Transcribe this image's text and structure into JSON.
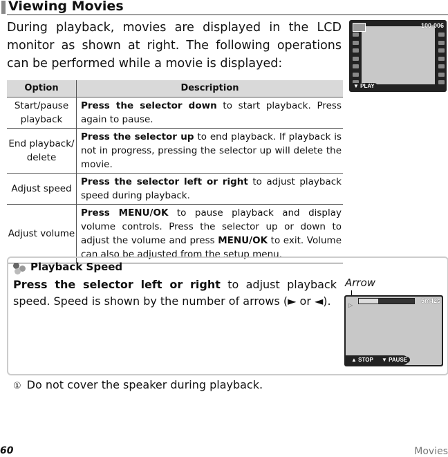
{
  "heading": "Viewing Movies",
  "intro": "During playback, movies are displayed in the LCD monitor as shown at right.  The following operations can be performed while a movie is displayed:",
  "lcd1": {
    "frame_no": "100-006",
    "play_label": "PLAY",
    "icon": "movie-icon"
  },
  "table": {
    "headers": [
      "Option",
      "Description"
    ],
    "rows": [
      {
        "option": "Start/pause playback",
        "bold": "Press the selector down",
        "rest": " to start playback.  Press again to pause."
      },
      {
        "option": "End playback/ delete",
        "bold": "Press the selector up",
        "rest": " to end playback.  If playback is not in progress, pressing the selector up will delete the movie."
      },
      {
        "option": "Adjust speed",
        "bold": "Press the selector left or right",
        "rest": " to adjust playback speed during playback."
      },
      {
        "option": "Adjust volume",
        "bold": "Press MENU/OK",
        "rest": " to pause playback and display volume controls.  Press the selector up or down to adjust the volume and press ",
        "bold2": "MENU/OK",
        "rest2": " to exit.  Volume can also be adjusted from the setup menu."
      }
    ]
  },
  "tip": {
    "title": "Playback Speed",
    "bold": "Press the selector left or right",
    "rest": " to adjust playback speed. Speed is shown by the number of arrows (► or ◄).",
    "arrow_label": "Arrow",
    "lcd2": {
      "time": "5m42s",
      "progress": 0.35,
      "stop_label": "STOP",
      "pause_label": "PAUSE"
    }
  },
  "note": {
    "icon": "caution-icon",
    "symbol": "①",
    "text": "Do not cover the speaker during playback."
  },
  "footer": {
    "page": "60",
    "section": "Movies"
  }
}
